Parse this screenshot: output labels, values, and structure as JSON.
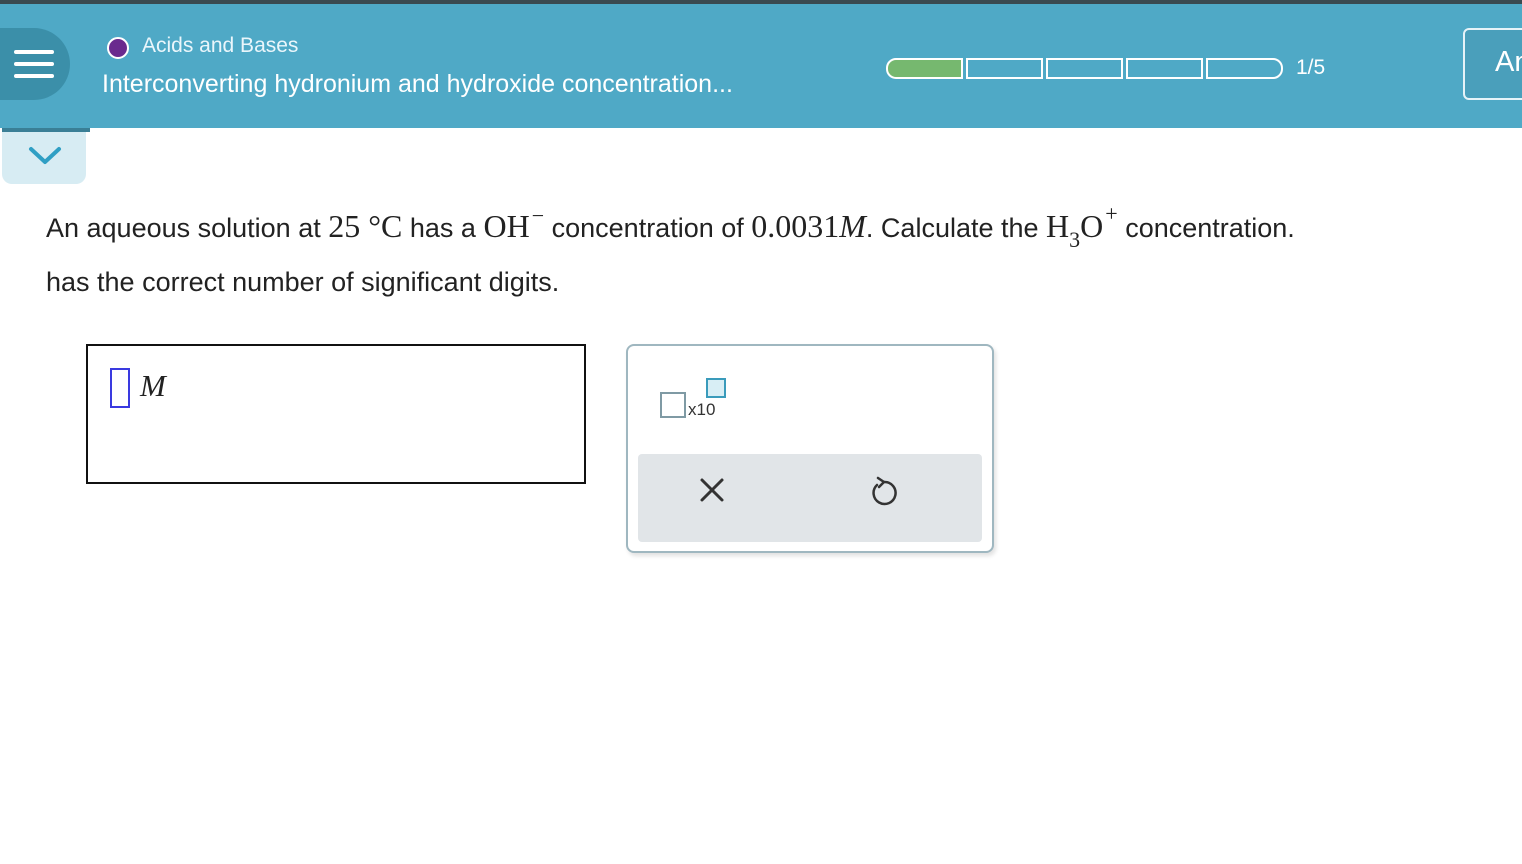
{
  "header": {
    "topic": "Acids and Bases",
    "title": "Interconverting hydronium and hydroxide concentration...",
    "progress_label": "1/5",
    "progress_value": 0.2,
    "answer_tab_label": "An"
  },
  "question": {
    "line1_part1": "An aqueous solution at",
    "temp_value": "25 °C",
    "line1_part2": "has a",
    "oh_formula": "OH",
    "oh_charge": "−",
    "line1_part3": "concentration of",
    "conc_value": "0.0031",
    "conc_unit": "M",
    "line1_part4": ". Calculate the",
    "h3o_h": "H",
    "h3o_sub": "3",
    "h3o_o": "O",
    "h3o_charge": "+",
    "line1_part5": "concentration.",
    "line2": "has the correct number of significant digits."
  },
  "answer": {
    "unit": "M"
  },
  "palette": {
    "sci_label": "x10"
  },
  "colors": {
    "header": "#4fa9c6",
    "progress_fill": "#76b86f",
    "topic_dot": "#6a2a8e"
  }
}
